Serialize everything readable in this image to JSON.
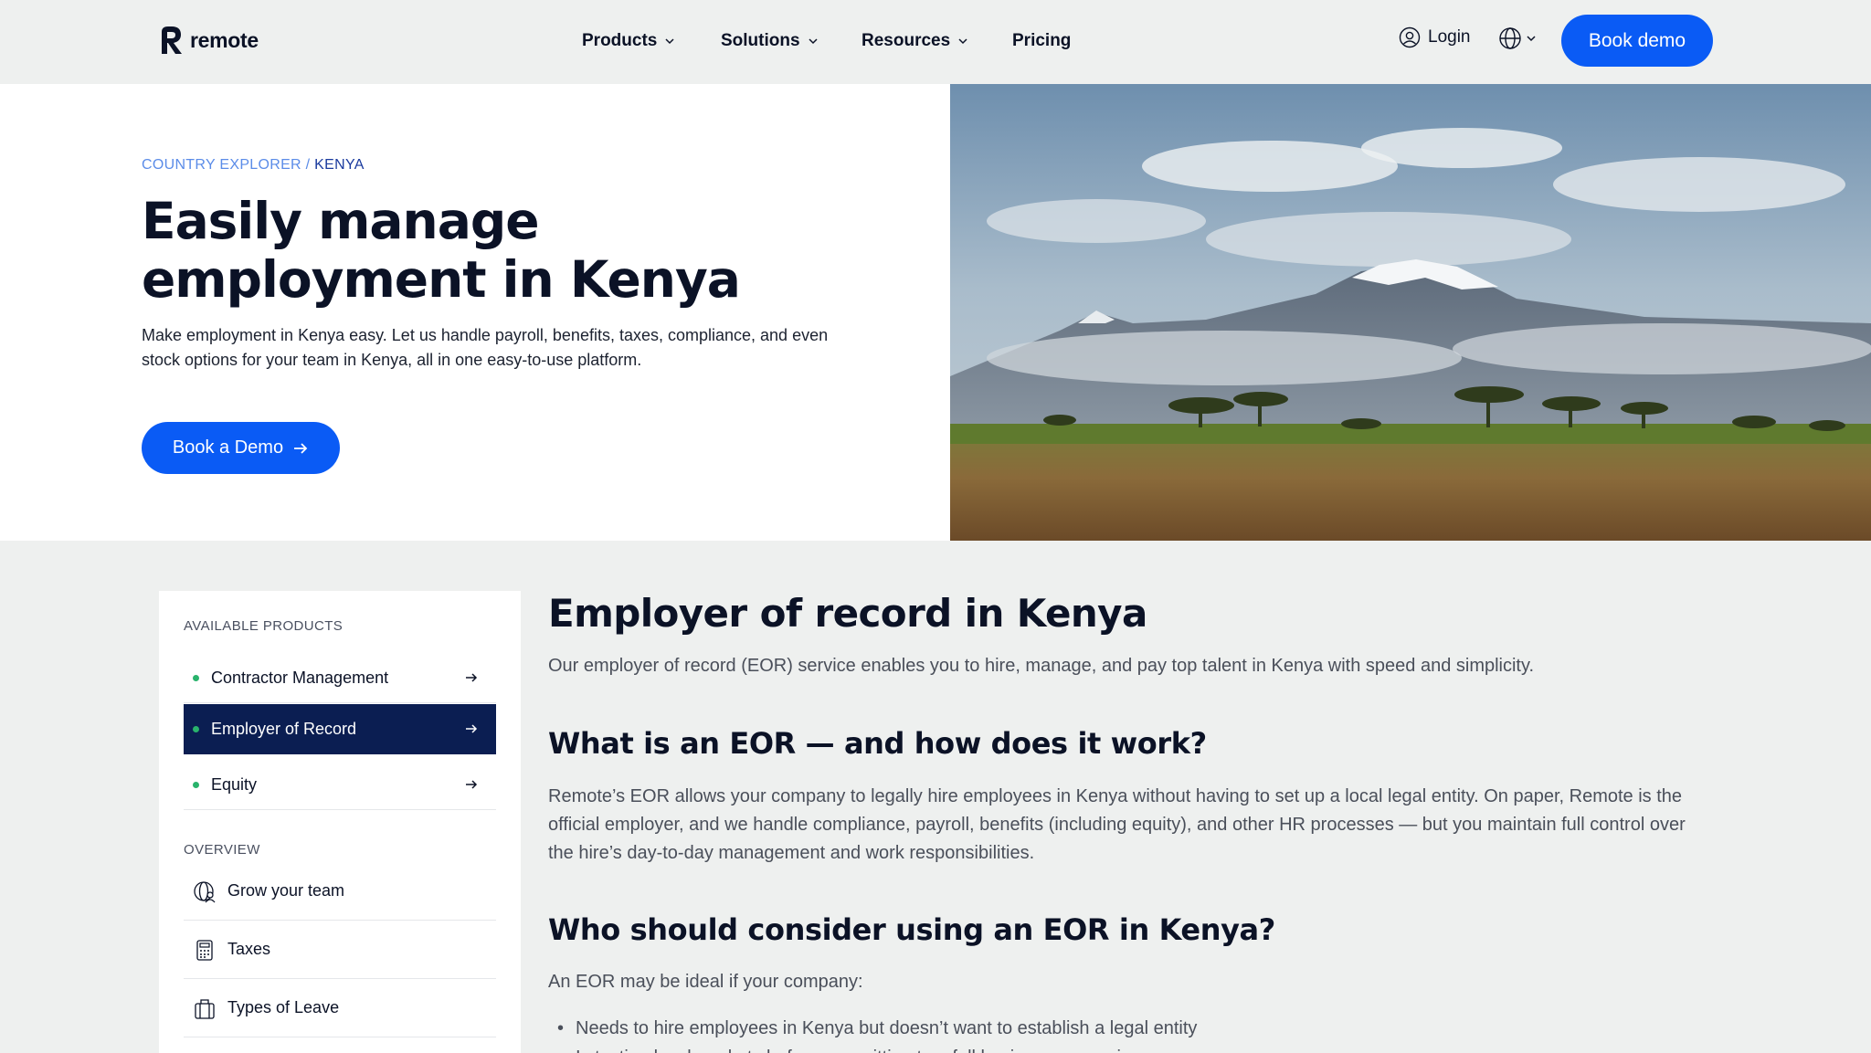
{
  "header": {
    "brand": "remote",
    "nav": [
      {
        "label": "Products"
      },
      {
        "label": "Solutions"
      },
      {
        "label": "Resources"
      },
      {
        "label": "Pricing"
      }
    ],
    "login_label": "Login",
    "book_demo_label": "Book demo"
  },
  "hero": {
    "breadcrumb_parent": "COUNTRY EXPLORER",
    "breadcrumb_sep": "/",
    "breadcrumb_current": "KENYA",
    "title": "Easily manage employment in Kenya",
    "description": "Make employment in Kenya easy. Let us handle payroll, benefits, taxes, compliance, and even stock options for your team in Kenya, all in one easy-to-use platform.",
    "cta_label": "Book a Demo"
  },
  "sidebar": {
    "products_heading": "AVAILABLE PRODUCTS",
    "products": [
      {
        "label": "Contractor Management"
      },
      {
        "label": "Employer of Record"
      },
      {
        "label": "Equity"
      }
    ],
    "overview_heading": "OVERVIEW",
    "overview": [
      {
        "label": "Grow your team",
        "icon": "globe-team-icon"
      },
      {
        "label": "Taxes",
        "icon": "calculator-icon"
      },
      {
        "label": "Types of Leave",
        "icon": "luggage-icon"
      }
    ]
  },
  "content": {
    "title": "Employer of record in Kenya",
    "intro": "Our employer of record (EOR) service enables you to hire, manage, and pay top talent in Kenya with speed and simplicity.",
    "section1_title": "What is an EOR — and how does it work?",
    "section1_body": "Remote’s EOR allows your company to legally hire employees in Kenya without having to set up a local legal entity. On paper, Remote is the official employer, and we handle compliance, payroll, benefits (including equity), and other HR processes — but you maintain full control over the hire’s day-to-day management and work responsibilities.",
    "section2_title": "Who should consider using an EOR in Kenya?",
    "section2_lead": "An EOR may be ideal if your company:",
    "bullets": [
      "Needs to hire employees in Kenya but doesn’t want to establish a legal entity",
      "Is testing local markets before committing to a full business expansion"
    ]
  },
  "colors": {
    "accent": "#0a5bf5",
    "active_item": "#0b1e52",
    "status_dot": "#29b36c"
  }
}
